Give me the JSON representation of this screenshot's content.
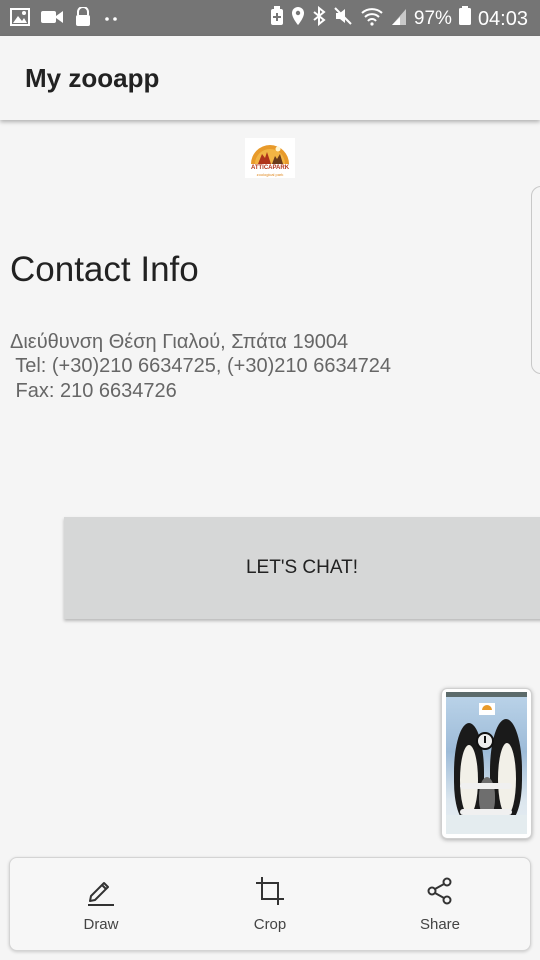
{
  "status_bar": {
    "battery": "97%",
    "time": "04:03",
    "left_icons": [
      "image-icon",
      "video-camera-icon",
      "lock-screen-icon",
      "more-dots-icon"
    ],
    "right_icons": [
      "battery-saver-icon",
      "location-icon",
      "bluetooth-icon",
      "mute-icon",
      "wifi-icon",
      "signal-icon",
      "battery-icon"
    ]
  },
  "app_bar": {
    "title": "My zooapp"
  },
  "logo": {
    "name": "ATTICAPARK",
    "tagline": "zoological park"
  },
  "contact": {
    "heading": "Contact Info",
    "address": "Διεύθυνση Θέση Γιαλού, Σπάτα 19004",
    "tel": " Tel: (+30)210 6634725, (+30)210 6634724",
    "fax": " Fax: 210 6634726"
  },
  "chat_button": {
    "label": "LET'S CHAT!"
  },
  "thumbnail": {
    "button1": "ANIMAL INFORMATION",
    "button2": "CONTACT INFO"
  },
  "toolbar": {
    "draw": "Draw",
    "crop": "Crop",
    "share": "Share"
  },
  "colors": {
    "status_bar": "#757575",
    "background": "#f5f5f5",
    "button": "#d6d7d7"
  }
}
